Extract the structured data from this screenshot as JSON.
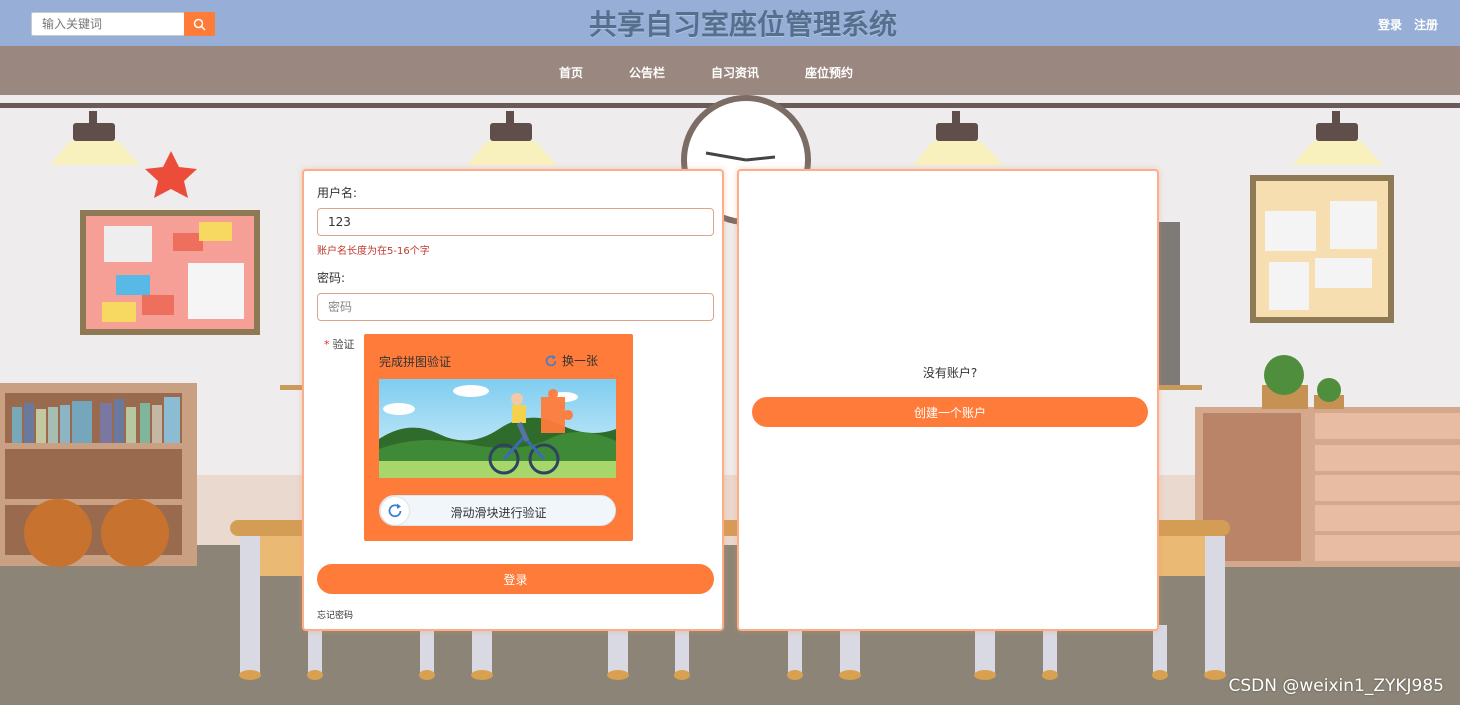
{
  "header": {
    "search_placeholder": "输入关键词",
    "title": "共享自习室座位管理系统",
    "login_link": "登录",
    "register_link": "注册"
  },
  "nav": {
    "items": [
      "首页",
      "公告栏",
      "自习资讯",
      "座位预约"
    ]
  },
  "login_form": {
    "username_label": "用户名:",
    "username_value": "123",
    "username_error": "账户名长度为在5-16个字",
    "password_label": "密码:",
    "password_placeholder": "密码",
    "verify_label": "验证",
    "captcha_title": "完成拼图验证",
    "captcha_refresh": "换一张",
    "slider_text": "滑动滑块进行验证",
    "submit_label": "登录",
    "forgot_label": "忘记密码"
  },
  "register_panel": {
    "prompt": "没有账户?",
    "create_label": "创建一个账户"
  },
  "watermark": "CSDN @weixin1_ZYKJ985",
  "colors": {
    "header_bg": "#97aed6",
    "nav_bg": "#9a877f",
    "accent": "#ff7b3a",
    "title": "#55708f",
    "error": "#c0392b"
  }
}
